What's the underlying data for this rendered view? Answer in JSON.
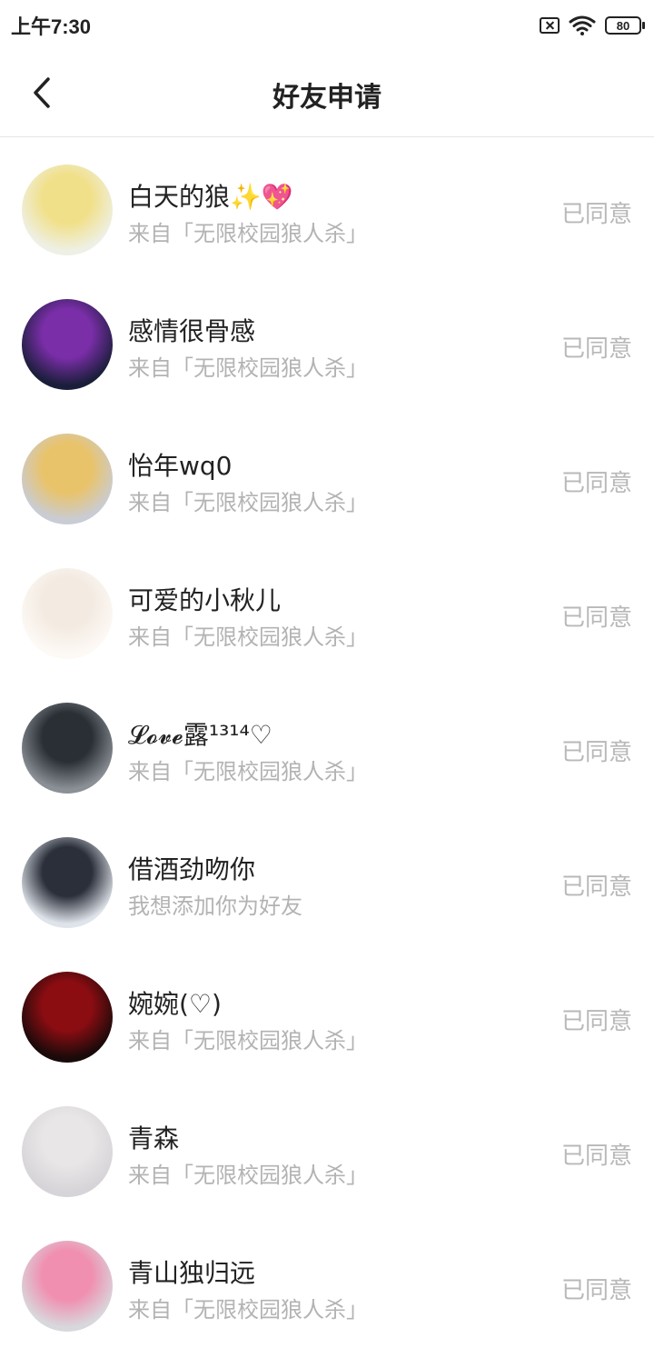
{
  "status_bar": {
    "time": "上午7:30",
    "battery": "80"
  },
  "header": {
    "title": "好友申请"
  },
  "requests": [
    {
      "name": "白天的狼✨💖",
      "source": "来自「无限校园狼人杀」",
      "status": "已同意",
      "avatar_colors": [
        "#f1e08a",
        "#eef0e6"
      ]
    },
    {
      "name": "感情很骨感",
      "source": "来自「无限校园狼人杀」",
      "status": "已同意",
      "avatar_colors": [
        "#7a2ea8",
        "#1a1e3a"
      ]
    },
    {
      "name": "怡年wq0",
      "source": "来自「无限校园狼人杀」",
      "status": "已同意",
      "avatar_colors": [
        "#e9c36a",
        "#c9ccd4"
      ]
    },
    {
      "name": "可爱的小秋儿",
      "source": "来自「无限校园狼人杀」",
      "status": "已同意",
      "avatar_colors": [
        "#f3ebe2",
        "#fdf9f5"
      ]
    },
    {
      "name": "𝓛𝓸𝓿𝓮露¹³¹⁴♡",
      "source": "来自「无限校园狼人杀」",
      "status": "已同意",
      "avatar_colors": [
        "#2a2f36",
        "#8a9096"
      ]
    },
    {
      "name": "借酒劲吻你",
      "source": "我想添加你为好友",
      "status": "已同意",
      "avatar_colors": [
        "#2b2f3a",
        "#dfe3ea"
      ]
    },
    {
      "name": "婉婉(♡)",
      "source": "来自「无限校园狼人杀」",
      "status": "已同意",
      "avatar_colors": [
        "#8b0d12",
        "#1a0a0a"
      ]
    },
    {
      "name": "青森",
      "source": "来自「无限校园狼人杀」",
      "status": "已同意",
      "avatar_colors": [
        "#e8e6e6",
        "#d6d4d8"
      ]
    },
    {
      "name": "青山独归远",
      "source": "来自「无限校园狼人杀」",
      "status": "已同意",
      "avatar_colors": [
        "#f08fb0",
        "#d8d8dc"
      ]
    }
  ]
}
